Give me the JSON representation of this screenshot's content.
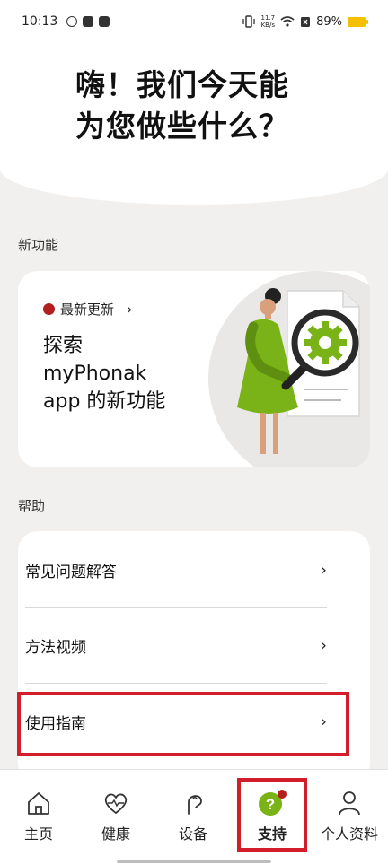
{
  "status_bar": {
    "time": "10:13",
    "speed_value": "11.7",
    "speed_unit": "KB/s",
    "battery": "89%"
  },
  "header": {
    "line1": "嗨！我们今天能",
    "line2": "为您做些什么？"
  },
  "new_features": {
    "section_label": "新功能",
    "badge": "最新更新",
    "title_line1": "探索",
    "title_line2": "myPhonak",
    "title_line3": "app 的新功能"
  },
  "help": {
    "section_label": "帮助",
    "items": [
      {
        "label": "常见问题解答"
      },
      {
        "label": "方法视频"
      },
      {
        "label": "使用指南"
      }
    ]
  },
  "nav": {
    "items": [
      {
        "label": "主页",
        "icon": "home-icon"
      },
      {
        "label": "健康",
        "icon": "heart-icon"
      },
      {
        "label": "设备",
        "icon": "hearing-aid-icon"
      },
      {
        "label": "支持",
        "icon": "question-icon"
      },
      {
        "label": "个人资料",
        "icon": "person-icon"
      }
    ],
    "active": "支持"
  },
  "colors": {
    "accent_green": "#7ab317",
    "notification_red": "#b21f1f",
    "highlight_red": "#d11e2a"
  }
}
